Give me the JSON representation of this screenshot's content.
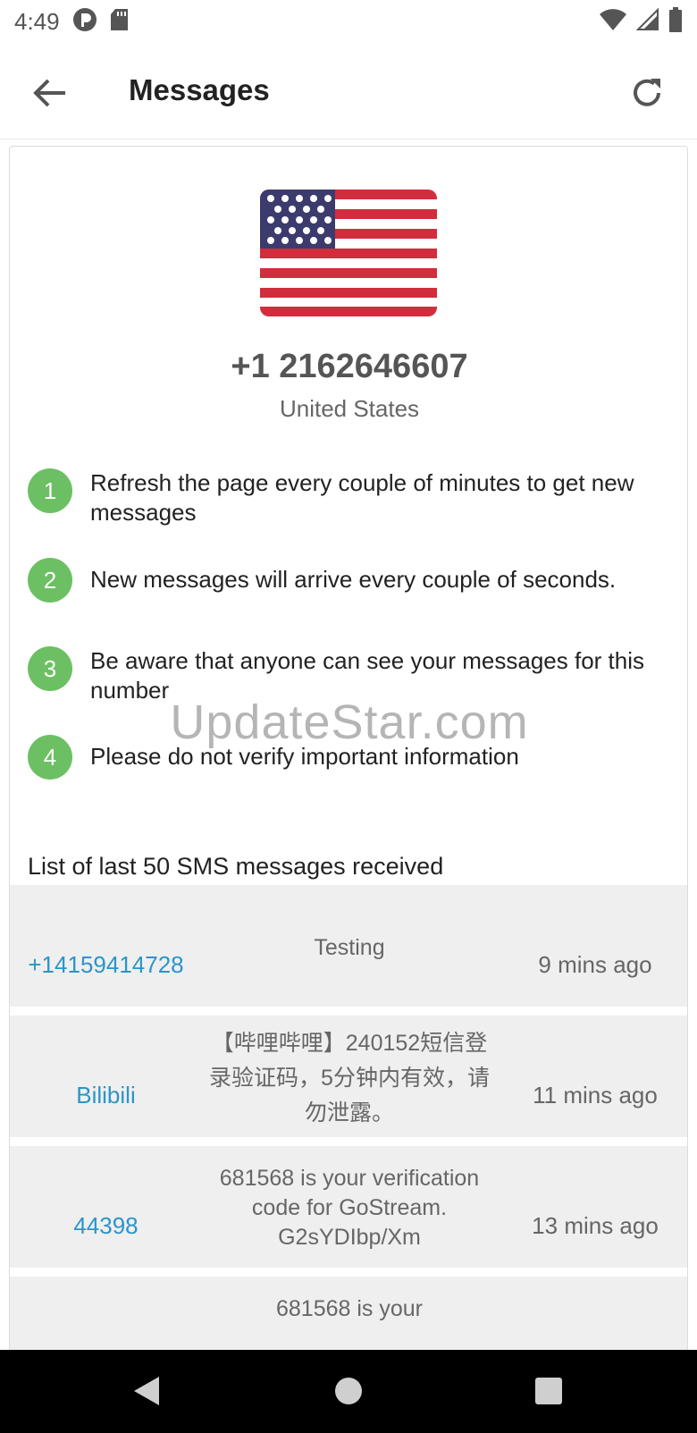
{
  "status_bar": {
    "time": "4:49"
  },
  "app_bar": {
    "title": "Messages"
  },
  "number": {
    "phone": "+1 2162646607",
    "country": "United States"
  },
  "tips": [
    {
      "num": "1",
      "text": "Refresh the page every couple of minutes to get new messages"
    },
    {
      "num": "2",
      "text": "New messages will arrive every couple of seconds."
    },
    {
      "num": "3",
      "text": "Be aware that anyone can see your messages for this number"
    },
    {
      "num": "4",
      "text": "Please do not verify important information"
    }
  ],
  "watermark": "UpdateStar.com",
  "list_title": "List of last 50 SMS messages received",
  "messages": [
    {
      "sender": "+14159414728",
      "body": "Testing",
      "time": "9 mins ago"
    },
    {
      "sender": "Bilibili",
      "body": "【哔哩哔哩】240152短信登录验证码，5分钟内有效，请勿泄露。",
      "time": "11 mins ago"
    },
    {
      "sender": "44398",
      "body": "681568 is your verification code for GoStream. G2sYDIbp/Xm",
      "time": "13 mins ago"
    },
    {
      "sender": "",
      "body": "681568 is your",
      "time": ""
    }
  ],
  "colors": {
    "accent_green": "#6cc063",
    "link_blue": "#2a95c9",
    "row_bg": "#efefef"
  }
}
